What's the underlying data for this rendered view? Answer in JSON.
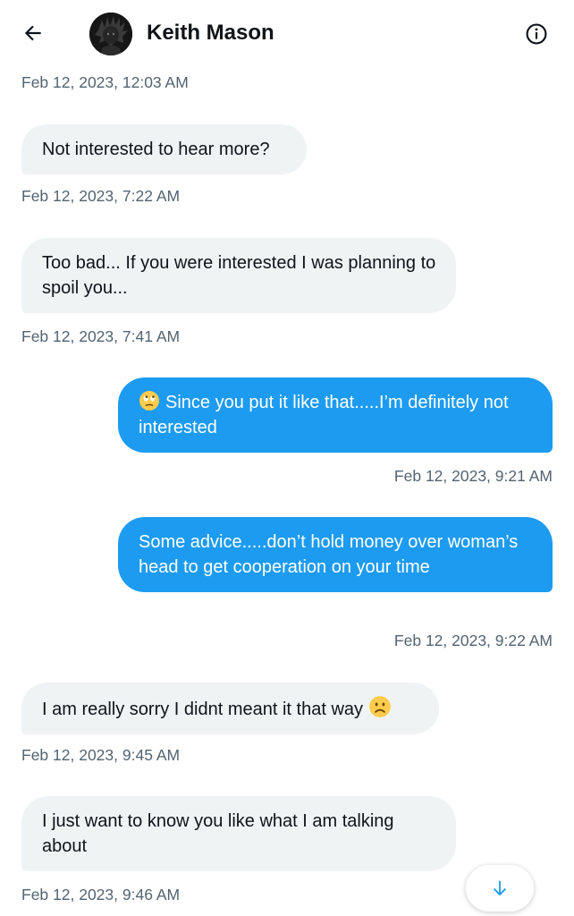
{
  "header": {
    "contact_name": "Keith Mason",
    "back_icon": "arrow-left-icon",
    "info_icon": "info-circle-icon"
  },
  "colors": {
    "sent_bubble": "#1d9bf0",
    "received_bubble": "#eff3f4",
    "timestamp": "#536471",
    "text": "#0f1419"
  },
  "conversation": {
    "top_timestamp": "Feb 12, 2023, 12:03 AM",
    "messages": [
      {
        "direction": "received",
        "text": "Not interested to hear more?",
        "timestamp": "Feb 12, 2023, 7:22 AM"
      },
      {
        "direction": "received",
        "text": "Too bad... If you were interested I was planning to spoil you...",
        "timestamp": "Feb 12, 2023, 7:41 AM"
      },
      {
        "direction": "sent",
        "emoji": "face-with-rolling-eyes",
        "text": "Since you put it like that.....I’m definitely not interested",
        "timestamp": "Feb 12, 2023, 9:21 AM"
      },
      {
        "direction": "sent",
        "text": "Some advice.....don’t hold money over woman’s head to get cooperation on your time",
        "timestamp": "Feb 12, 2023, 9:22 AM"
      },
      {
        "direction": "received",
        "text": "I am really sorry I didnt meant it that way",
        "emoji": "slightly-frowning-face",
        "timestamp": "Feb 12, 2023, 9:45 AM"
      },
      {
        "direction": "received",
        "text": "I just want to know you like what I am talking about",
        "timestamp": "Feb 12, 2023, 9:46 AM"
      }
    ]
  },
  "scroll_button_icon": "arrow-down-icon"
}
